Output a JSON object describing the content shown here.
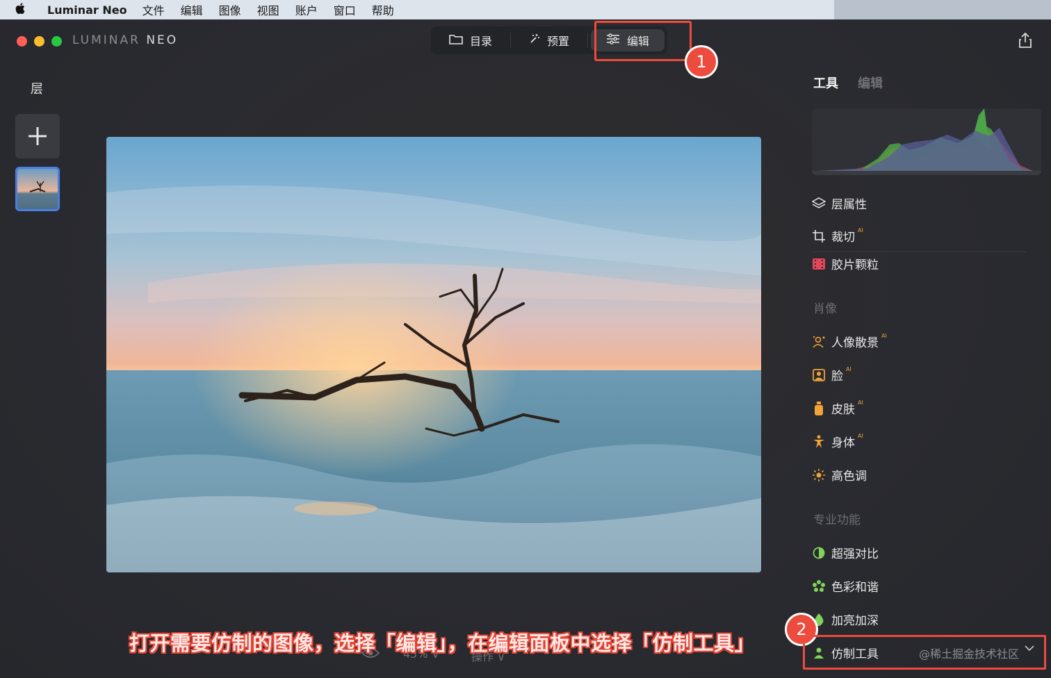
{
  "menubar": {
    "app_name": "Luminar Neo",
    "items": [
      "文件",
      "编辑",
      "图像",
      "视图",
      "账户",
      "窗口",
      "帮助"
    ]
  },
  "window": {
    "brand_part1": "LUMINAR",
    "brand_part2": "NEO",
    "nav": {
      "catalog": "目录",
      "presets": "预置",
      "edit": "编辑"
    },
    "badge1": "1",
    "badge2": "2"
  },
  "layers": {
    "title": "层"
  },
  "bottom": {
    "zoom": "45% ∨",
    "actions": "操作 ∨"
  },
  "caption": "打开需要仿制的图像，选择「编辑」，在编辑面板中选择「仿制工具」",
  "panel": {
    "tab_tools": "工具",
    "tab_edit": "编辑",
    "tools_top": [
      {
        "label": "层属性",
        "icon": "layers-icon",
        "ai": ""
      },
      {
        "label": "裁切",
        "icon": "crop-icon",
        "ai": "AI"
      },
      {
        "label": "胶片颗粒",
        "icon": "film-grain-icon",
        "ai": ""
      }
    ],
    "section_portrait": "肖像",
    "tools_portrait": [
      {
        "label": "人像散景",
        "icon": "portrait-bokeh-icon",
        "ai": "AI"
      },
      {
        "label": "脸",
        "icon": "face-icon",
        "ai": "AI"
      },
      {
        "label": "皮肤",
        "icon": "skin-icon",
        "ai": "AI"
      },
      {
        "label": "身体",
        "icon": "body-icon",
        "ai": "AI"
      },
      {
        "label": "高色调",
        "icon": "high-key-icon",
        "ai": ""
      }
    ],
    "section_pro": "专业功能",
    "tools_pro": [
      {
        "label": "超强对比",
        "icon": "supercontrast-icon",
        "ai": ""
      },
      {
        "label": "色彩和谐",
        "icon": "color-harmony-icon",
        "ai": ""
      },
      {
        "label": "加亮加深",
        "icon": "dodge-burn-icon",
        "ai": ""
      },
      {
        "label": "仿制工具",
        "icon": "clone-icon",
        "ai": ""
      }
    ],
    "watermark": "@稀土掘金技术社区"
  },
  "colors": {
    "highlight": "#ec4b3d",
    "accent_blue": "#4a7ee0",
    "ai_badge": "#e6a23c"
  }
}
